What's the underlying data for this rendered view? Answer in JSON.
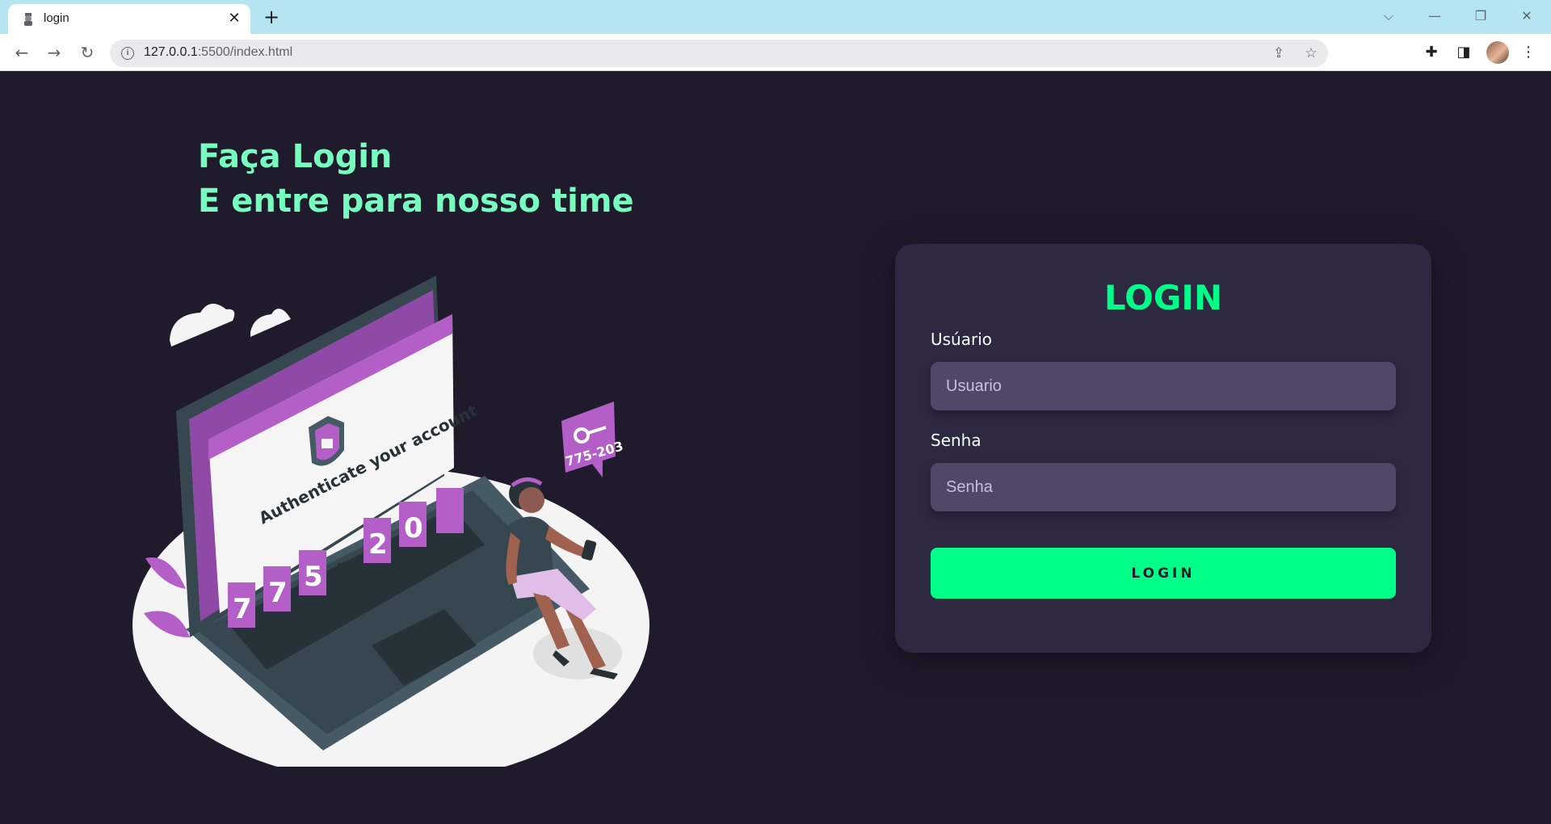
{
  "browser": {
    "tab_title": "login",
    "url_host": "127.0.0.1",
    "url_rest": ":5500/index.html"
  },
  "page": {
    "headline_line1": "Faça Login",
    "headline_line2": "E entre para nosso time",
    "illustration": {
      "caption": "Authenticate your account",
      "code_digits": [
        "7",
        "7",
        "5",
        "-",
        "2",
        "0"
      ],
      "bubble_code": "775-203"
    },
    "login": {
      "title": "LOGIN",
      "user_label": "Usúario",
      "user_placeholder": "Usuario",
      "pass_label": "Senha",
      "pass_placeholder": "Senha",
      "button_label": "LOGIN"
    }
  },
  "colors": {
    "background": "#201b2c",
    "card": "#2f2841",
    "input": "#514869",
    "accent": "#00ff88",
    "headline": "#77ffc0",
    "illustration_purple": "#b45fc8"
  }
}
